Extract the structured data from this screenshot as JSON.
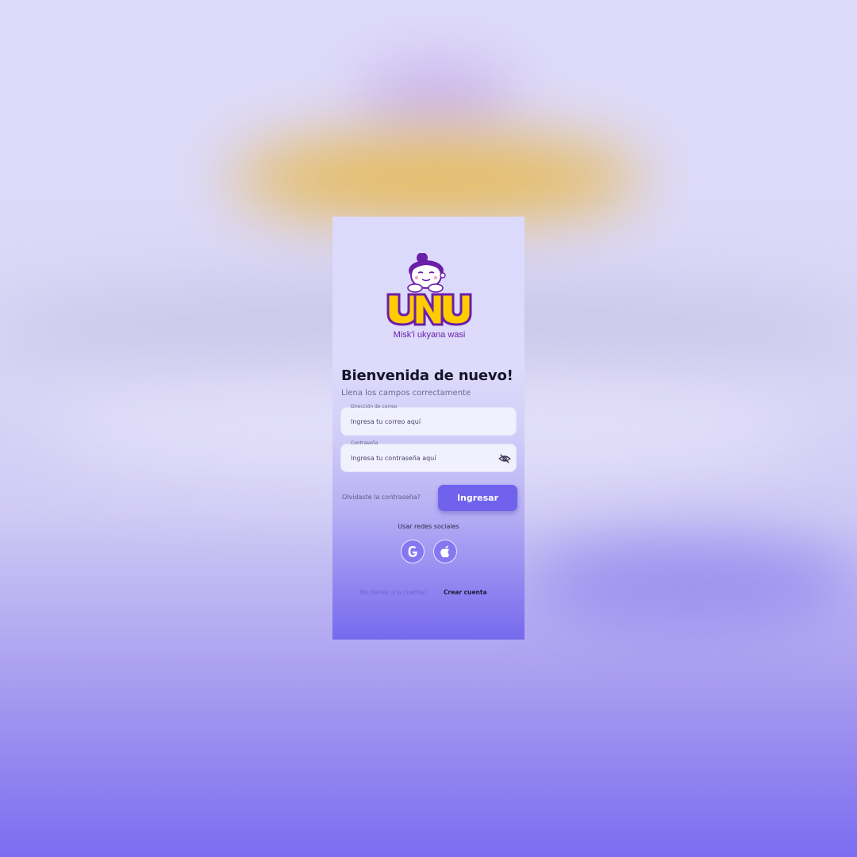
{
  "brand": {
    "name": "UNU",
    "tagline": "Misk'i ukyana wasi",
    "logo_yellow": "#ffcc00",
    "logo_purple": "#6a1fa8"
  },
  "login": {
    "title": "Bienvenida de nuevo!",
    "subtitle": "Llena los campos correctamente",
    "email": {
      "label": "Dirección de correo",
      "placeholder": "Ingresa tu correo aquí",
      "value": ""
    },
    "password": {
      "label": "Contraseña",
      "placeholder": "Ingresa tu contraseña aquí",
      "value": "",
      "toggle_icon": "eye-slash-icon"
    },
    "forgot_password": "Olvidaste la contraseña?",
    "submit_label": "Ingresar",
    "social_label": "Usar redes sociales",
    "social_buttons": [
      {
        "provider": "google",
        "icon": "google-icon"
      },
      {
        "provider": "apple",
        "icon": "apple-icon"
      }
    ],
    "no_account": "No tienes una cuenta?",
    "create_account": "Crear cuenta"
  },
  "colors": {
    "accent": "#7062ed",
    "title_text": "#17142b"
  }
}
